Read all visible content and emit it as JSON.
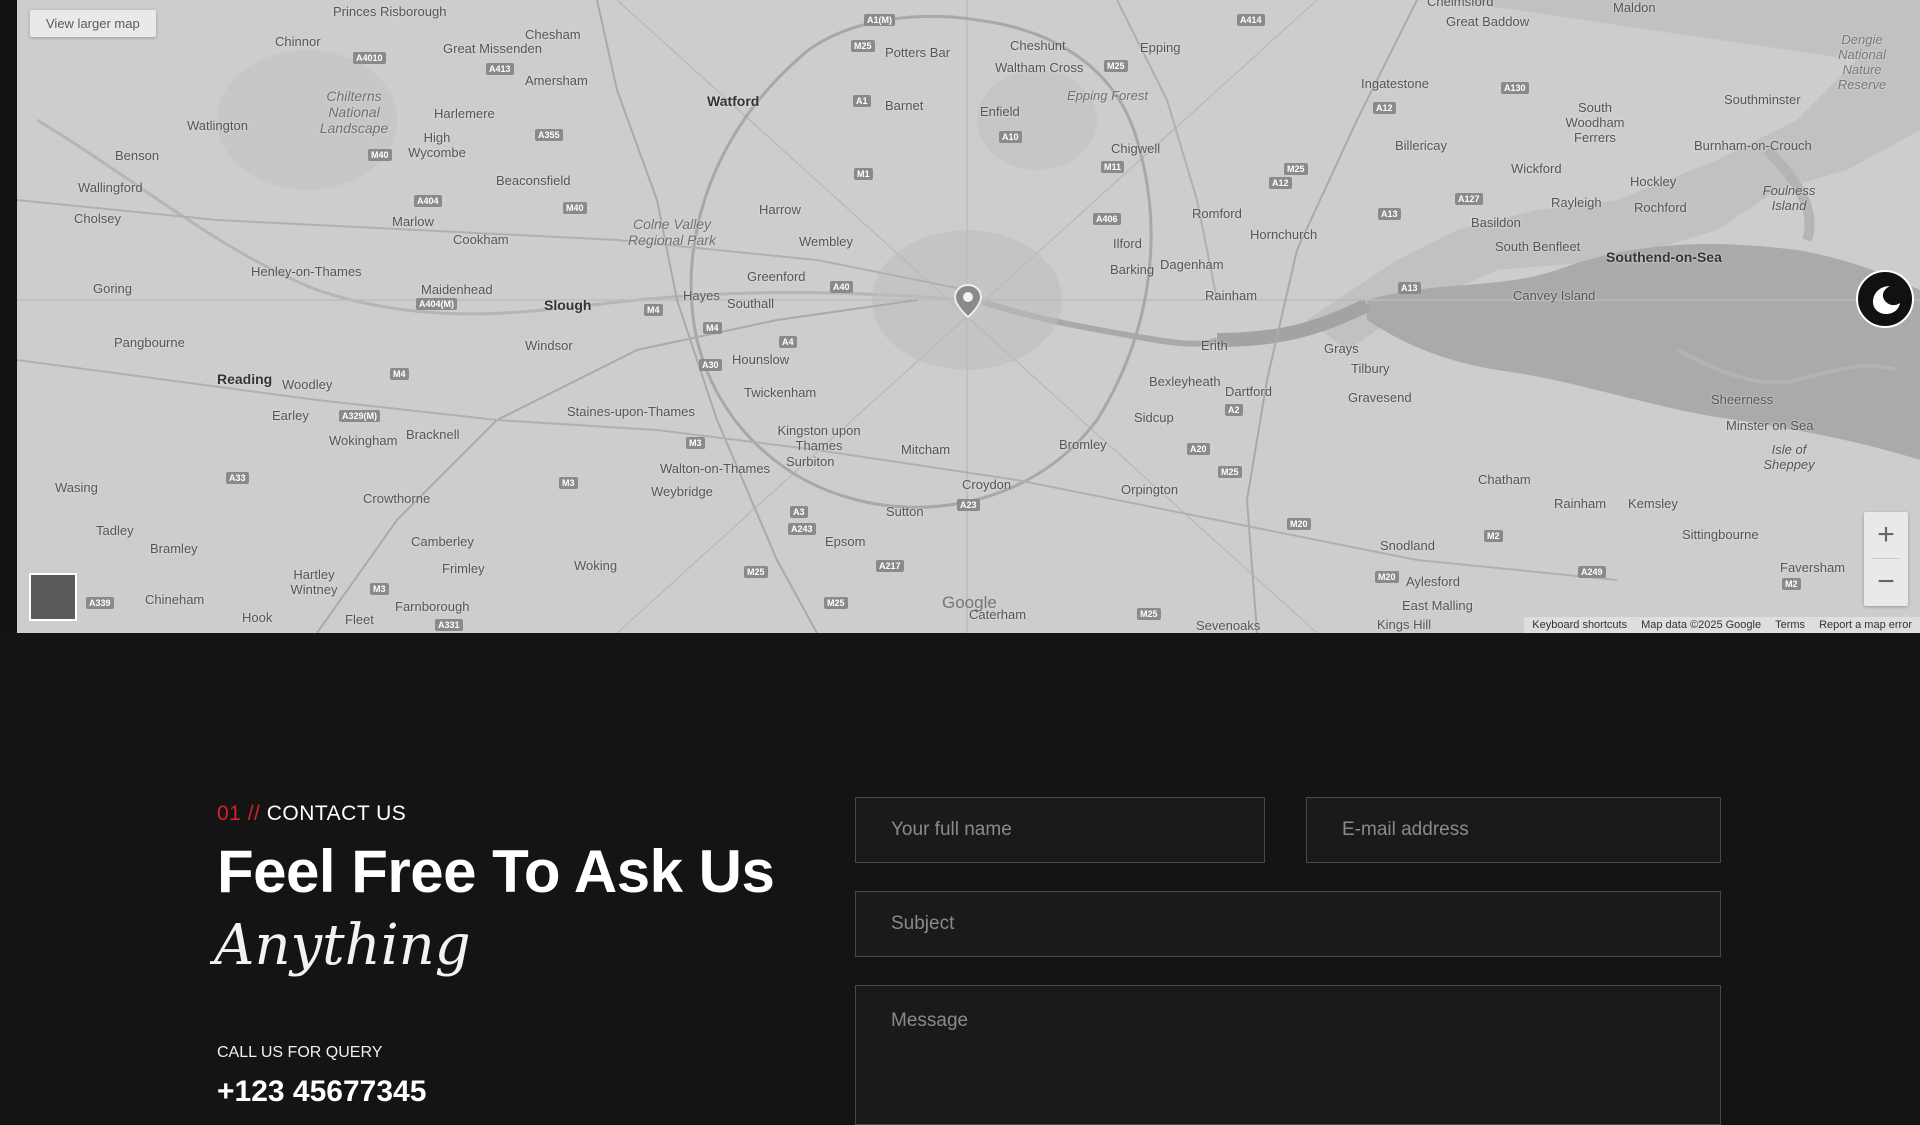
{
  "map": {
    "view_larger_label": "View larger map",
    "google_logo": "Google",
    "attribution": [
      "Keyboard shortcuts",
      "Map data ©2025 Google",
      "Terms",
      "Report a map error"
    ],
    "zoom_in": "+",
    "zoom_out": "−",
    "places": [
      "Chinnor",
      "Princes Risborough",
      "Chesham",
      "Great Missenden",
      "Amersham",
      "Potters Bar",
      "Cheshunt",
      "Waltham Cross",
      "Epping",
      "Great Baddow",
      "Maldon",
      "Watford",
      "Barnet",
      "Enfield",
      "Epping Forest",
      "Ingatestone",
      "South Woodham Ferrers",
      "Southminster",
      "Watlington",
      "Chilterns National Landscape",
      "Harlemere",
      "High Wycombe",
      "Chigwell",
      "Billericay",
      "Burnham-on-Crouch",
      "Benson",
      "Wallingford",
      "Beaconsfield",
      "Harrow",
      "Romford",
      "Wickford",
      "Hockley",
      "Foulness Island",
      "Cholsey",
      "Marlow",
      "Colne Valley Regional Park",
      "Wembley",
      "Ilford",
      "Hornchurch",
      "Rayleigh",
      "Rochford",
      "Cookham",
      "Greenford",
      "Basildon",
      "South Benfleet",
      "Southend-on-Sea",
      "Henley-on-Thames",
      "Barking",
      "Dagenham",
      "Goring",
      "Maidenhead",
      "Slough",
      "Hayes",
      "Southall",
      "Rainham",
      "Canvey Island",
      "Pangbourne",
      "Windsor",
      "Hounslow",
      "Erith",
      "Grays",
      "Tilbury",
      "Reading",
      "Woodley",
      "Twickenham",
      "Bexleyheath",
      "Dartford",
      "Gravesend",
      "Sheerness",
      "Earley",
      "Wokingham",
      "Bracknell",
      "Staines-upon-Thames",
      "Kingston upon Thames",
      "Mitcham",
      "Bromley",
      "Sidcup",
      "Minster on Sea",
      "Isle of Sheppey",
      "Surbiton",
      "Walton-on-Thames",
      "Weybridge",
      "Chatham",
      "Wasing",
      "Crowthorne",
      "Croydon",
      "Orpington",
      "Rainham",
      "Kemsley",
      "Sutton",
      "Tadley",
      "Camberley",
      "Epsom",
      "Snodland",
      "Sittingbourne",
      "Bramley",
      "Frimley",
      "Woking",
      "Aylesford",
      "Faversham",
      "Hartley Wintney",
      "Chineham",
      "Farnborough",
      "Hook",
      "Fleet",
      "Caterham",
      "Sevenoaks",
      "East Malling",
      "Kings Hill",
      "Dengie National Nature Reserve",
      "Chelmsford"
    ],
    "roads": [
      "A1(M)",
      "M25",
      "A414",
      "A130",
      "A4010",
      "A413",
      "A1",
      "M25",
      "A12",
      "A355",
      "M40",
      "A10",
      "M1",
      "M11",
      "A404",
      "M40",
      "A406",
      "A127",
      "A12",
      "A13",
      "M25",
      "A404(M)",
      "M4",
      "A40",
      "A4",
      "A13",
      "A30",
      "M4",
      "A329(M)",
      "M4",
      "M3",
      "A20",
      "A2",
      "A33",
      "M3",
      "A3",
      "A23",
      "M25",
      "M20",
      "M2",
      "A243",
      "M3",
      "A217",
      "M25",
      "A249",
      "M20",
      "M2",
      "M25",
      "M25",
      "A339",
      "A331"
    ],
    "dark_mode_icon": "moon-icon"
  },
  "contact": {
    "eyebrow_number": "01 //",
    "eyebrow_label": "CONTACT US",
    "heading": "Feel Free To Ask Us",
    "heading_italic": "Anything",
    "query_label": "CALL US FOR QUERY",
    "phone": "+123 45677345",
    "form": {
      "name_placeholder": "Your full name",
      "email_placeholder": "E-mail address",
      "subject_placeholder": "Subject",
      "message_placeholder": "Message"
    }
  },
  "colors": {
    "accent": "#d2232a",
    "background": "#141414",
    "field_border": "#4a4a4a"
  }
}
